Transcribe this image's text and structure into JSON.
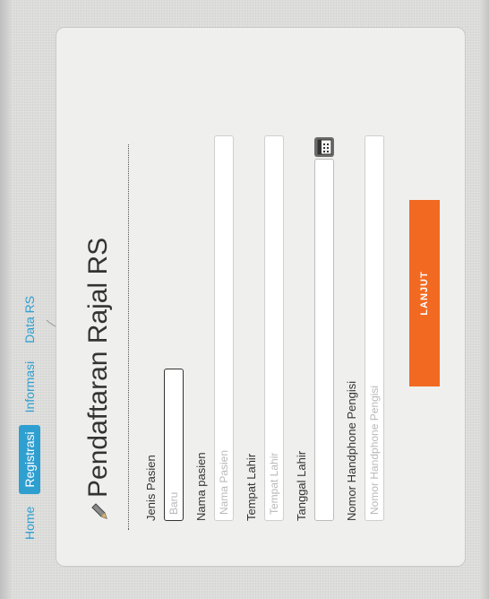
{
  "nav": {
    "items": [
      {
        "label": "Home",
        "active": false
      },
      {
        "label": "Registrasi",
        "active": true
      },
      {
        "label": "Informasi",
        "active": false
      },
      {
        "label": "Data RS",
        "active": false
      }
    ]
  },
  "form": {
    "title": "Pendaftaran Rajal RS",
    "fields": {
      "jenis_pasien": {
        "label": "Jenis Pasien",
        "value": "Baru"
      },
      "nama_pasien": {
        "label": "Nama pasien",
        "placeholder": "Nama Pasien"
      },
      "tempat_lahir": {
        "label": "Tempat Lahir",
        "placeholder": "Tempat Lahir"
      },
      "tanggal_lahir": {
        "label": "Tanggal Lahir",
        "icon": "calendar-icon"
      },
      "nomor_hp": {
        "label": "Nomor Handphone Pengisi",
        "placeholder": "Nomor Handphone Pengisi"
      }
    },
    "submit_label": "LANJUT"
  },
  "colors": {
    "accent": "#2f9fd0",
    "button": "#f26a22",
    "card": "#efefed"
  }
}
